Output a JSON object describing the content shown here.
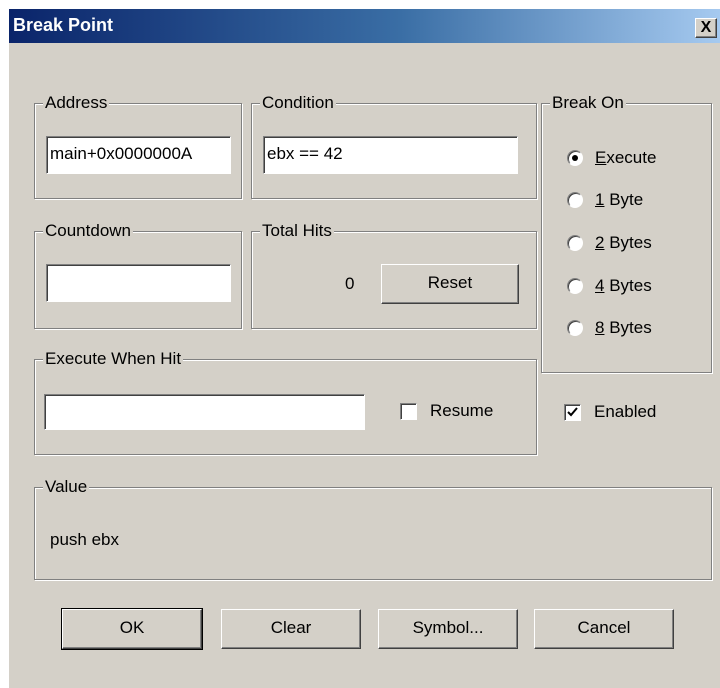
{
  "window": {
    "title": "Break Point",
    "close_glyph": "X"
  },
  "address": {
    "legend": "Address",
    "value": "main+0x0000000A"
  },
  "condition": {
    "legend": "Condition",
    "value": "ebx == 42"
  },
  "break_on": {
    "legend": "Break On",
    "options": [
      {
        "acc": "E",
        "rest": "xecute",
        "selected": true
      },
      {
        "acc": "1",
        "rest": " Byte",
        "selected": false
      },
      {
        "acc": "2",
        "rest": " Bytes",
        "selected": false
      },
      {
        "acc": "4",
        "rest": " Bytes",
        "selected": false
      },
      {
        "acc": "8",
        "rest": " Bytes",
        "selected": false
      }
    ]
  },
  "countdown": {
    "legend": "Countdown",
    "value": ""
  },
  "total_hits": {
    "legend": "Total Hits",
    "count": "0",
    "reset_label": "Reset"
  },
  "execute_when_hit": {
    "legend": "Execute When Hit",
    "value": "",
    "resume_label": "Resume",
    "resume_checked": false
  },
  "enabled": {
    "label": "Enabled",
    "checked": true
  },
  "value_group": {
    "legend": "Value",
    "text": "push ebx"
  },
  "buttons": {
    "ok": "OK",
    "clear": "Clear",
    "symbol": "Symbol...",
    "cancel": "Cancel"
  }
}
